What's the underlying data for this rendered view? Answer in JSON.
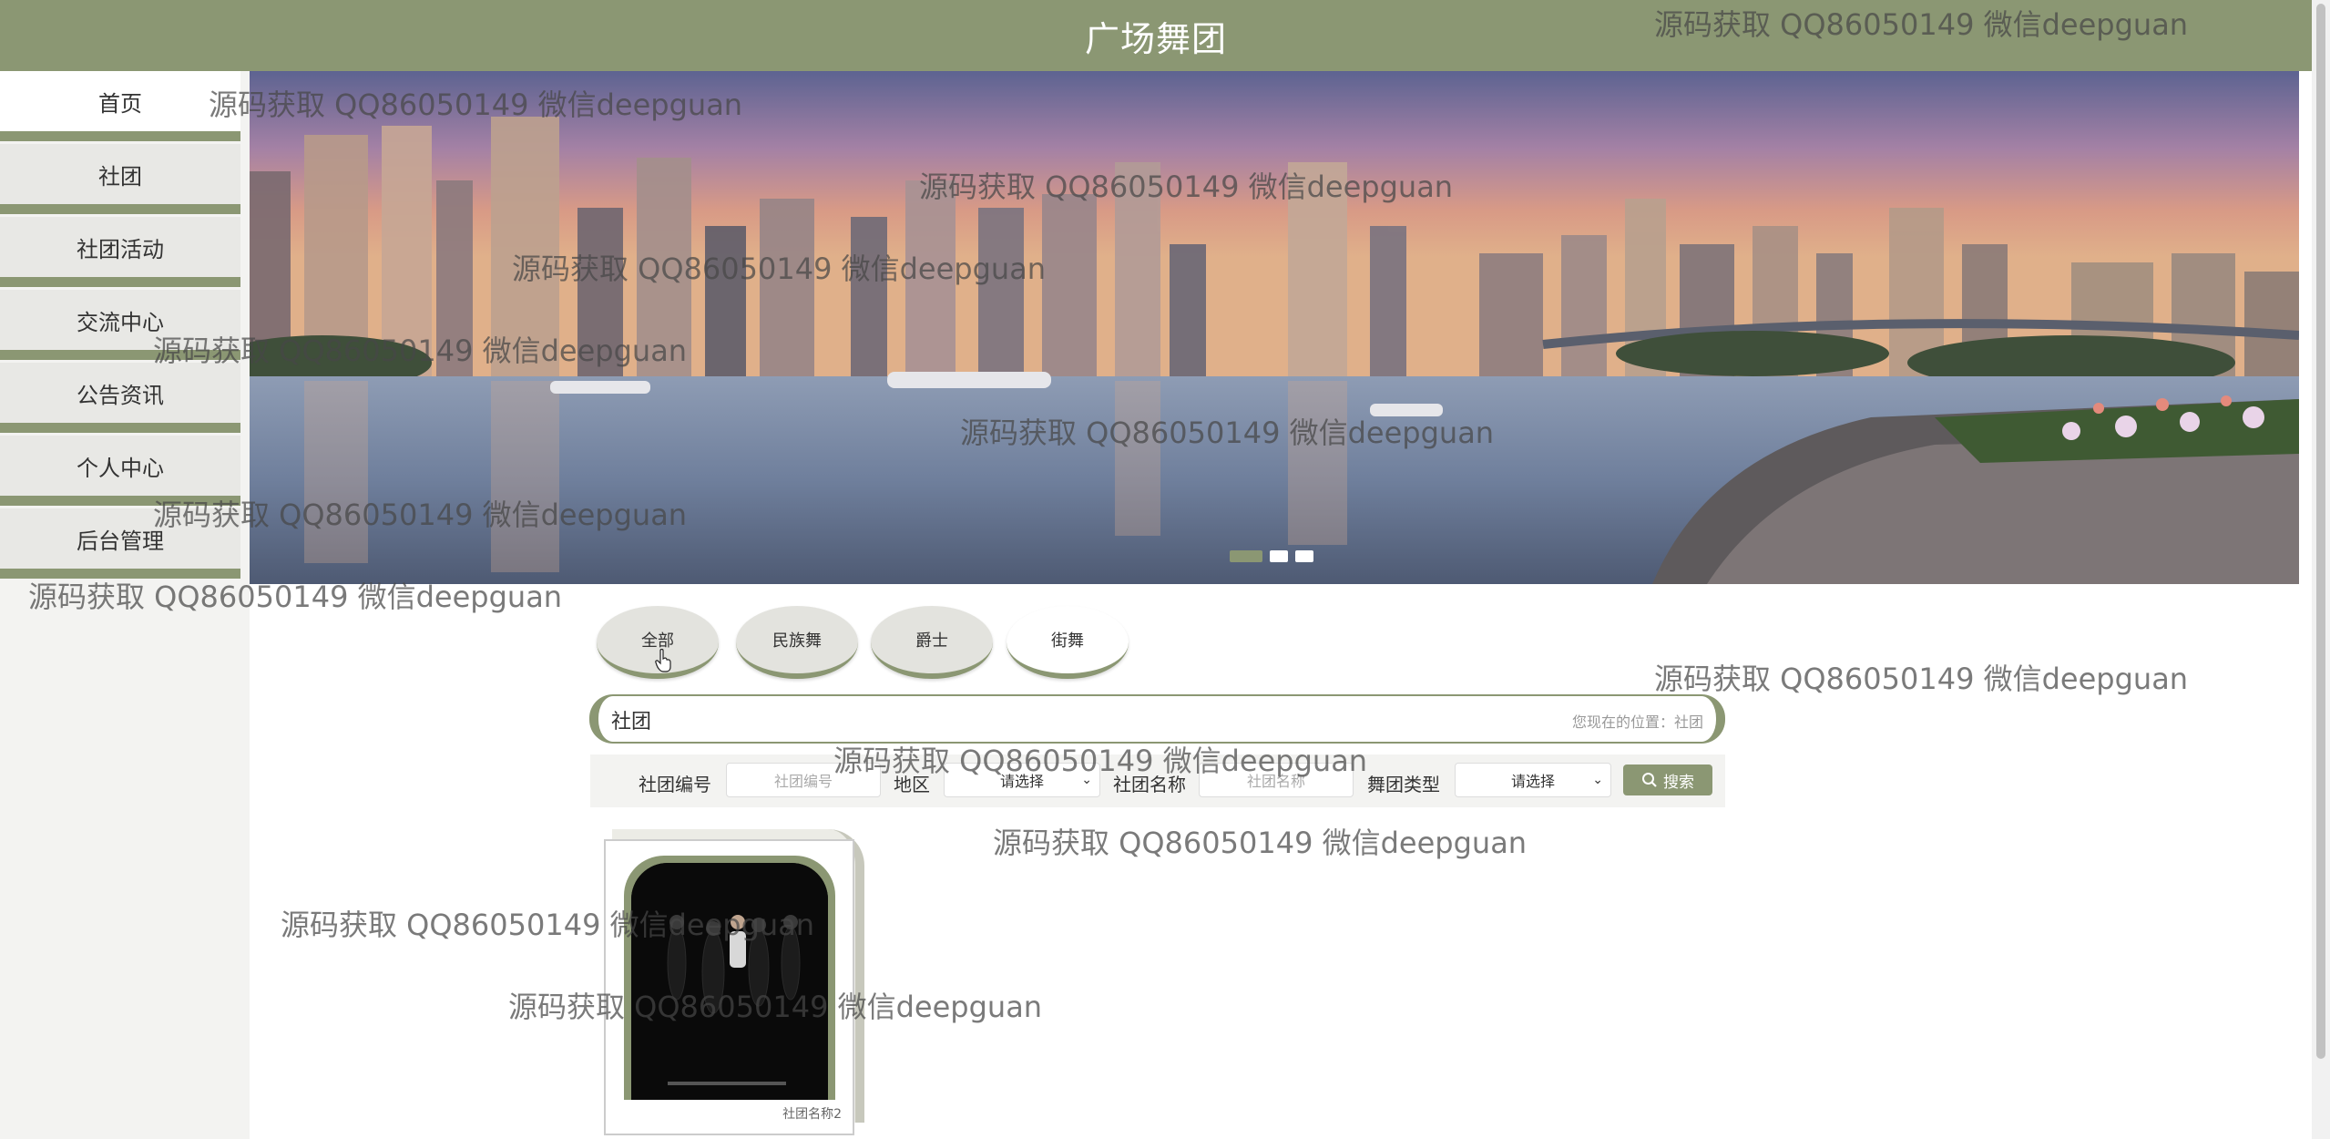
{
  "header": {
    "title": "广场舞团"
  },
  "sidebar": {
    "items": [
      {
        "label": "首页",
        "active": true
      },
      {
        "label": "社团"
      },
      {
        "label": "社团活动"
      },
      {
        "label": "交流中心"
      },
      {
        "label": "公告资讯"
      },
      {
        "label": "个人中心"
      },
      {
        "label": "后台管理"
      }
    ]
  },
  "banner": {
    "slides": 3,
    "active_slide": 1
  },
  "categories": [
    "全部",
    "民族舞",
    "爵士",
    "街舞"
  ],
  "breadcrumb": {
    "title": "社团",
    "location": "您现在的位置：社团"
  },
  "search": {
    "club_no_label": "社团编号",
    "club_no_placeholder": "社团编号",
    "region_label": "地区",
    "region_value": "请选择",
    "club_name_label": "社团名称",
    "club_name_placeholder": "社团名称",
    "type_label": "舞团类型",
    "type_value": "请选择",
    "button_label": "搜索"
  },
  "cards": [
    {
      "name": "社团名称2"
    }
  ],
  "watermark": "源码获取 QQ86050149 微信deepguan",
  "colors": {
    "accent": "#8b9773",
    "sidebar_bg": "#f3f3f1"
  }
}
